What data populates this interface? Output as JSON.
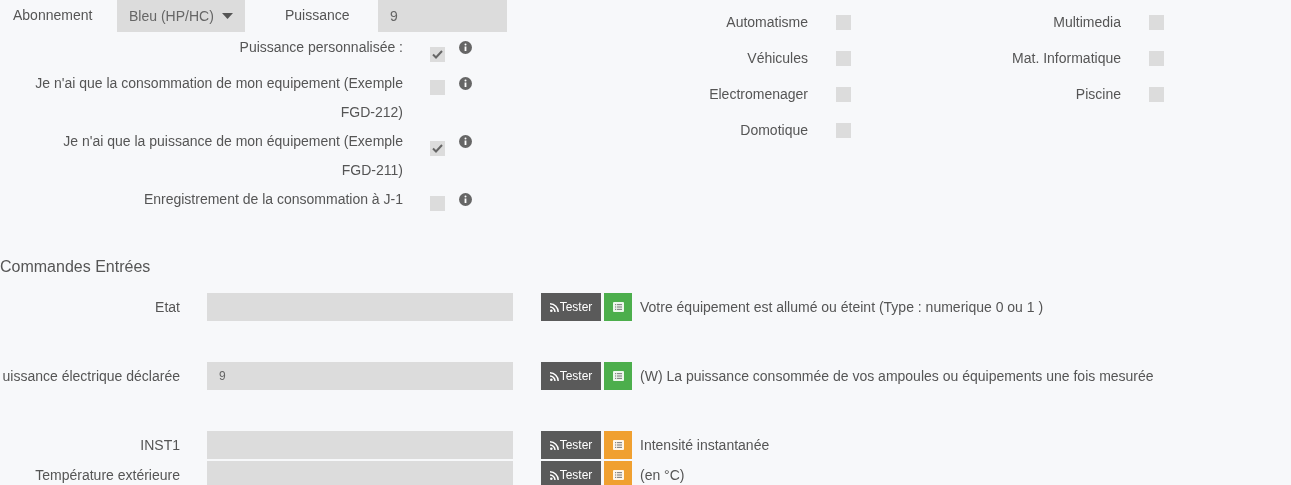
{
  "subscription": {
    "label": "Abonnement",
    "value": "Bleu (HP/HC)"
  },
  "power": {
    "label": "Puissance",
    "value": "9"
  },
  "options": [
    {
      "label": "Puissance personnalisée :",
      "checked": true
    },
    {
      "label": "Je n'ai que la consommation de mon equipement (Exemple FGD-212)",
      "checked": false
    },
    {
      "label": "Je n'ai que la puissance de mon équipement (Exemple FGD-211)",
      "checked": true
    },
    {
      "label": "Enregistrement de la consommation à J-1",
      "checked": false
    }
  ],
  "categories": [
    {
      "label": "Automatisme",
      "checked": false
    },
    {
      "label": "Véhicules",
      "checked": false
    },
    {
      "label": "Electromenager",
      "checked": false
    },
    {
      "label": "Domotique",
      "checked": false
    },
    {
      "label": "Multimedia",
      "checked": false
    },
    {
      "label": "Mat. Informatique",
      "checked": false
    },
    {
      "label": "Piscine",
      "checked": false
    }
  ],
  "commands": {
    "title": "Commandes Entrées",
    "rows": [
      {
        "label": "Etat",
        "value": "",
        "button": "Tester",
        "color": "#4cae4c",
        "description": "Votre équipement est allumé ou éteint (Type : numerique 0 ou 1 )"
      },
      {
        "label": "uissance électrique déclarée",
        "value": "9",
        "button": "Tester",
        "color": "#4cae4c",
        "description": "(W) La puissance consommée de vos ampoules ou équipements une fois mesurée"
      },
      {
        "label": "INST1",
        "value": "",
        "button": "Tester",
        "color": "#f0a030",
        "description": "Intensité instantanée"
      },
      {
        "label": "Température extérieure",
        "value": "",
        "button": "Tester",
        "color": "#f0a030",
        "description": "(en °C)"
      }
    ]
  }
}
